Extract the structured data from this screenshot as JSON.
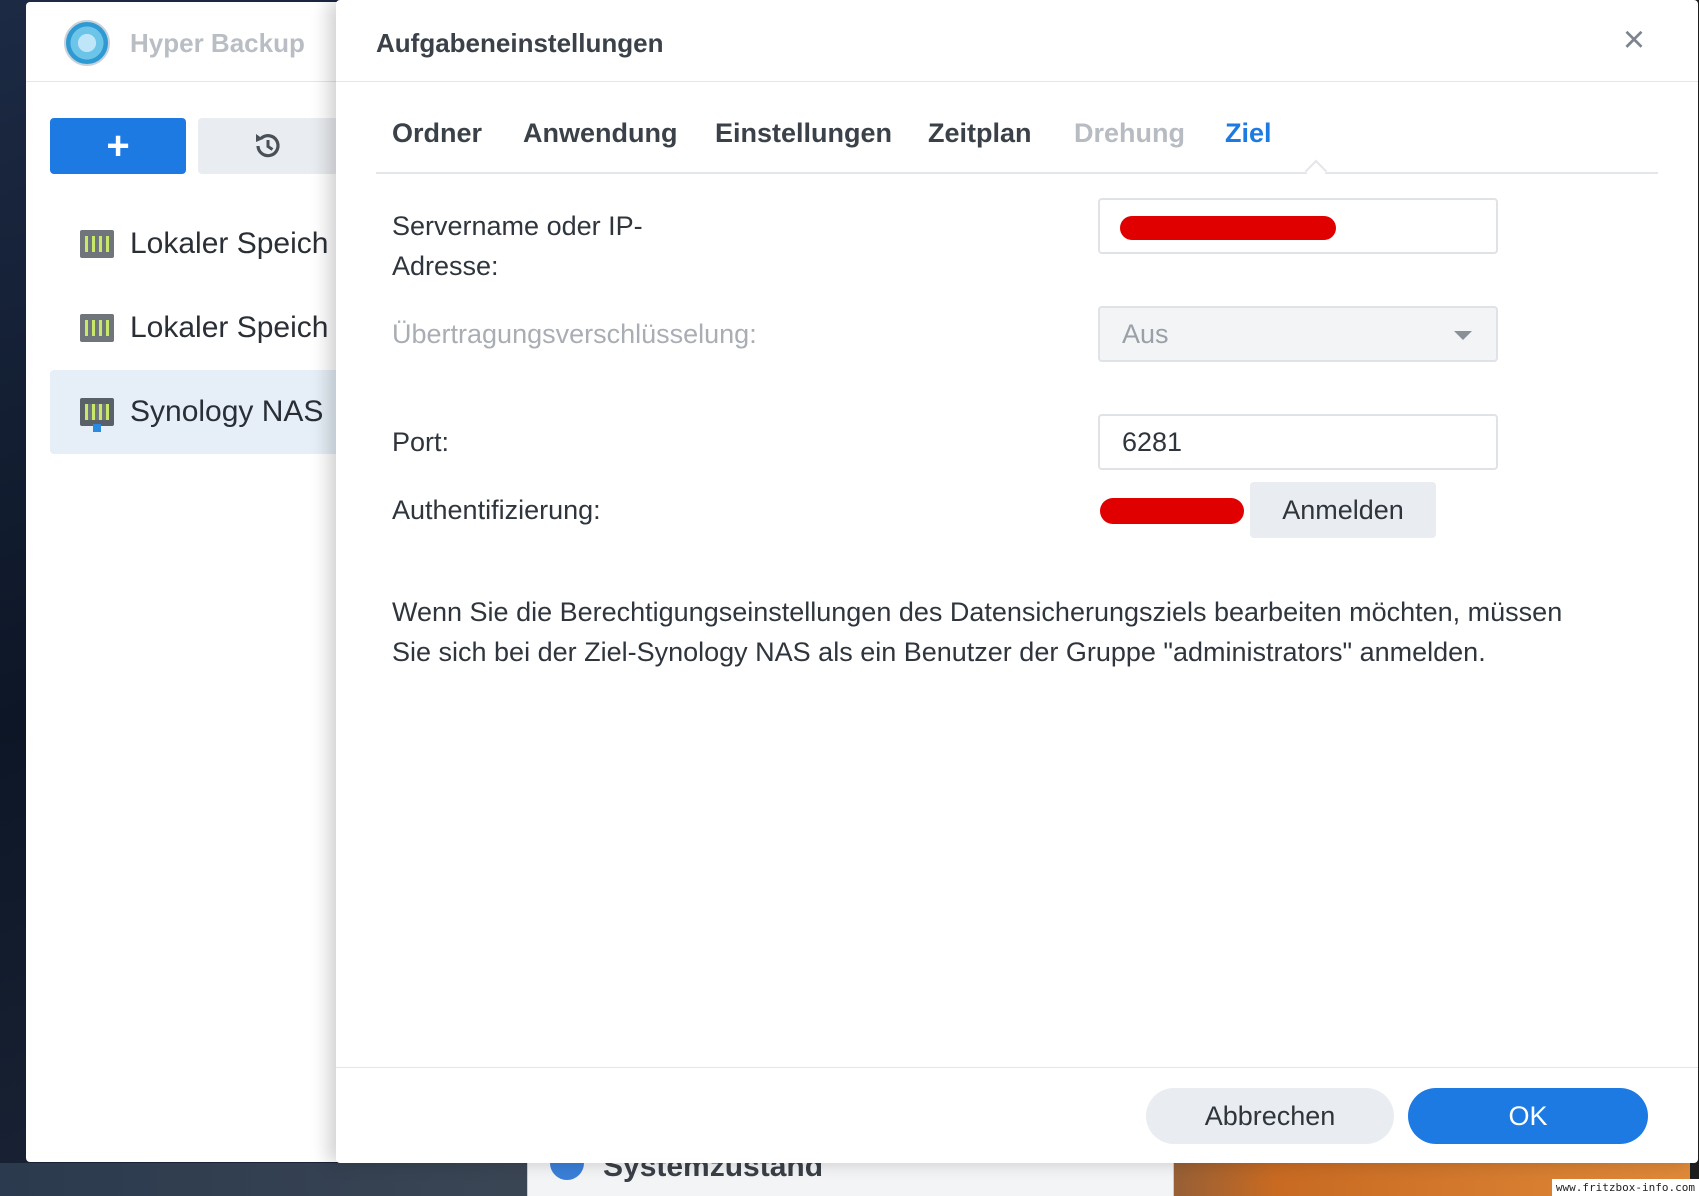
{
  "app": {
    "title": "Hyper Backup",
    "add_label": "+",
    "tasks": [
      {
        "label": "Lokaler Speich",
        "icon": "local-storage-icon"
      },
      {
        "label": "Lokaler Speich",
        "icon": "local-storage-icon"
      },
      {
        "label": "Synology NAS",
        "icon": "nas-server-icon"
      }
    ]
  },
  "dialog": {
    "title": "Aufgabeneinstellungen",
    "close_label": "×",
    "tabs": [
      {
        "label": "Ordner",
        "state": "normal"
      },
      {
        "label": "Anwendung",
        "state": "normal"
      },
      {
        "label": "Einstellungen",
        "state": "normal"
      },
      {
        "label": "Zeitplan",
        "state": "normal"
      },
      {
        "label": "Drehung",
        "state": "disabled"
      },
      {
        "label": "Ziel",
        "state": "active"
      }
    ],
    "form": {
      "server_label": "Servername oder IP-Adresse:",
      "encryption_label": "Übertragungsverschlüsselung:",
      "encryption_value": "Aus",
      "port_label": "Port:",
      "port_value": "6281",
      "auth_label": "Authentifizierung:",
      "login_button": "Anmelden"
    },
    "info_text": "Wenn Sie die Berechtigungseinstellungen des Datensicherungsziels bearbeiten möchten, müssen Sie sich bei der Ziel-Synology NAS als ein Benutzer der Gruppe \"administrators\" anmelden.",
    "footer": {
      "cancel_label": "Abbrechen",
      "ok_label": "OK"
    }
  },
  "background": {
    "peek_label": "Systemzustand",
    "watermark": "www.fritzbox-info.com"
  },
  "colors": {
    "accent": "#1d7ae3",
    "redaction": "#e00000"
  }
}
